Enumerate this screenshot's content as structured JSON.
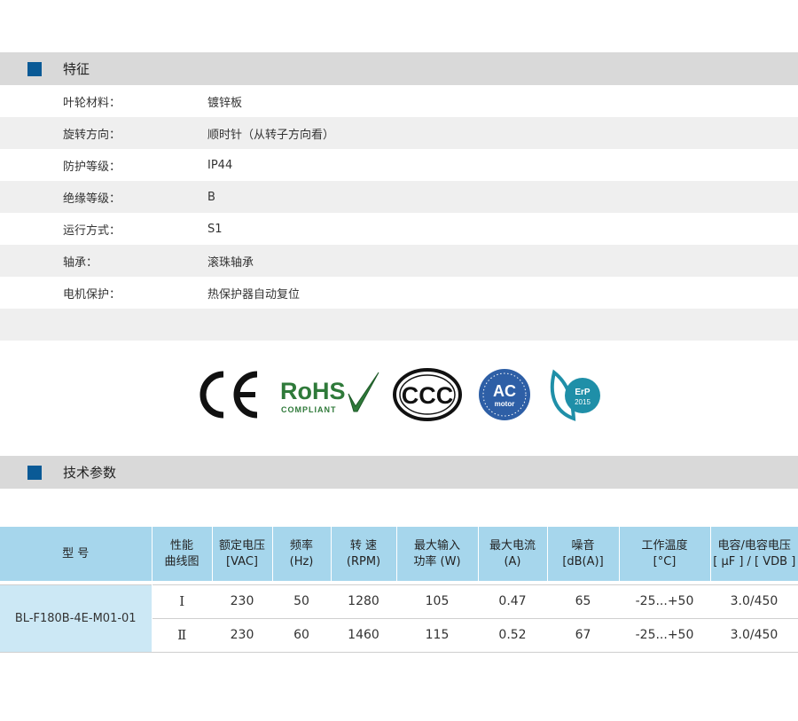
{
  "features": {
    "title": "特征",
    "rows": [
      {
        "label": "叶轮材料：",
        "value": "镀锌板"
      },
      {
        "label": "旋转方向：",
        "value": "顺时针（从转子方向看）"
      },
      {
        "label": "防护等级：",
        "value": "IP44"
      },
      {
        "label": "绝缘等级：",
        "value": "B"
      },
      {
        "label": "运行方式：",
        "value": "S1"
      },
      {
        "label": "轴承：",
        "value": "滚珠轴承"
      },
      {
        "label": "电机保护：",
        "value": "热保护器自动复位"
      }
    ]
  },
  "certifications": {
    "ce": "CE",
    "rohs": "RoHS",
    "rohs_sub": "COMPLIANT",
    "ccc": "CCC",
    "ac": "AC",
    "ac_sub": "motor",
    "erp": "ErP",
    "erp_year": "2015"
  },
  "tech": {
    "title": "技术参数",
    "headers": [
      [
        "型 号"
      ],
      [
        "性能",
        "曲线图"
      ],
      [
        "额定电压",
        "[VAC]"
      ],
      [
        "频率",
        "(Hz)"
      ],
      [
        "转 速",
        "(RPM)"
      ],
      [
        "最大输入",
        "功率 (W)"
      ],
      [
        "最大电流",
        "(A)"
      ],
      [
        "噪音",
        "[dB(A)]"
      ],
      [
        "工作温度",
        "[°C]"
      ],
      [
        "电容/电容电压",
        "[ μF ] / [ VDB ]"
      ]
    ],
    "model": "BL-F180B-4E-M01-01",
    "rows": [
      {
        "curve": "Ⅰ",
        "voltage": "230",
        "freq": "50",
        "speed": "1280",
        "power": "105",
        "current": "0.47",
        "noise": "65",
        "temp": "-25...+50",
        "cap": "3.0/450"
      },
      {
        "curve": "Ⅱ",
        "voltage": "230",
        "freq": "60",
        "speed": "1460",
        "power": "115",
        "current": "0.52",
        "noise": "67",
        "temp": "-25...+50",
        "cap": "3.0/450"
      }
    ]
  },
  "colors": {
    "accent_square": "#0a5a96",
    "header_bg": "#d9d9d9",
    "table_header_bg": "#a6d6ec",
    "model_cell_bg": "#cce8f5",
    "rohs_green": "#2f7a3a",
    "ac_blue": "#2e5fa6",
    "erp_teal": "#1f8fa8"
  }
}
